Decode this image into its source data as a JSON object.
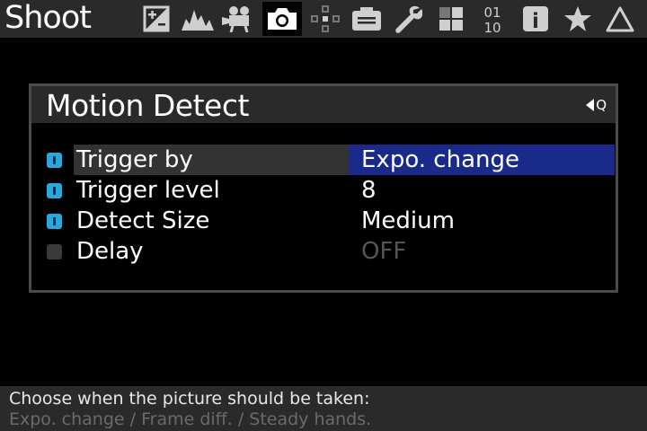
{
  "header": {
    "title": "Shoot",
    "tabs": [
      {
        "icon": "exposure-compensation-icon",
        "active": false
      },
      {
        "icon": "histogram-icon",
        "active": false
      },
      {
        "icon": "movie-camera-icon",
        "active": false
      },
      {
        "icon": "camera-icon",
        "active": true
      },
      {
        "icon": "focus-points-icon",
        "active": false
      },
      {
        "icon": "camera-setup-icon",
        "active": false
      },
      {
        "icon": "wrench-icon",
        "active": false
      },
      {
        "icon": "custom-grid-icon",
        "active": false
      },
      {
        "icon": "binary-icon",
        "active": false
      },
      {
        "icon": "info-icon",
        "active": false
      },
      {
        "icon": "star-icon",
        "active": false
      },
      {
        "icon": "triangle-icon",
        "active": false
      }
    ],
    "binary_top": "01",
    "binary_bottom": "10",
    "info_glyph": "i"
  },
  "panel": {
    "title": "Motion Detect",
    "back_label": "Q",
    "rows": [
      {
        "label": "Trigger by",
        "value": "Expo. change",
        "enabled": true,
        "selected": true
      },
      {
        "label": "Trigger level",
        "value": "8",
        "enabled": true,
        "selected": false
      },
      {
        "label": "Detect Size",
        "value": "Medium",
        "enabled": true,
        "selected": false
      },
      {
        "label": "Delay",
        "value": "OFF",
        "enabled": false,
        "selected": false
      }
    ]
  },
  "help": {
    "line1": "Choose when the picture should be taken:",
    "line2": "Expo. change / Frame diff. / Steady hands."
  },
  "colors": {
    "accent_blue": "#29a8e0",
    "selection_blue": "#1a2a8a",
    "bar_gray": "#2a2a2a"
  }
}
